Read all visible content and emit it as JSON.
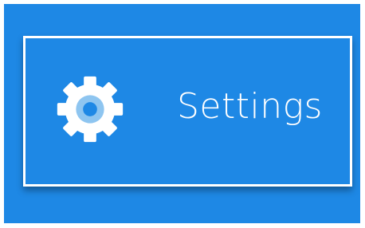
{
  "settings_tile": {
    "label": "Settings",
    "icon": "gear-icon"
  },
  "colors": {
    "background": "#1e88e5",
    "border": "#ffffff",
    "icon": "#ffffff",
    "icon_center": "#8ec5f0",
    "text": "#ffffff"
  }
}
